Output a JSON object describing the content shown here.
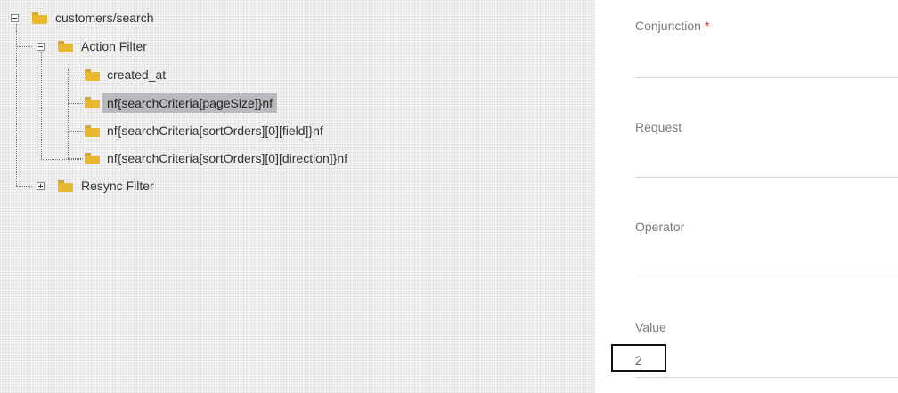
{
  "tree": {
    "root": {
      "label": "customers/search",
      "expanded": true
    },
    "action_filter": {
      "label": "Action Filter",
      "expanded": true,
      "children": [
        {
          "label": "created_at"
        },
        {
          "label": "nf{searchCriteria[pageSize]}nf",
          "selected": true
        },
        {
          "label": "nf{searchCriteria[sortOrders][0][field]}nf"
        },
        {
          "label": "nf{searchCriteria[sortOrders][0][direction]}nf"
        }
      ]
    },
    "resync_filter": {
      "label": "Resync Filter",
      "expanded": false
    }
  },
  "form": {
    "conjunction": {
      "label": "Conjunction",
      "required_mark": "*",
      "value": ""
    },
    "request": {
      "label": "Request",
      "value": ""
    },
    "operator": {
      "label": "Operator",
      "value": ""
    },
    "value": {
      "label": "Value",
      "value": "2"
    }
  },
  "colors": {
    "folder": "#e8b82e",
    "selected_bg": "#b9babd",
    "required": "#e22626"
  }
}
